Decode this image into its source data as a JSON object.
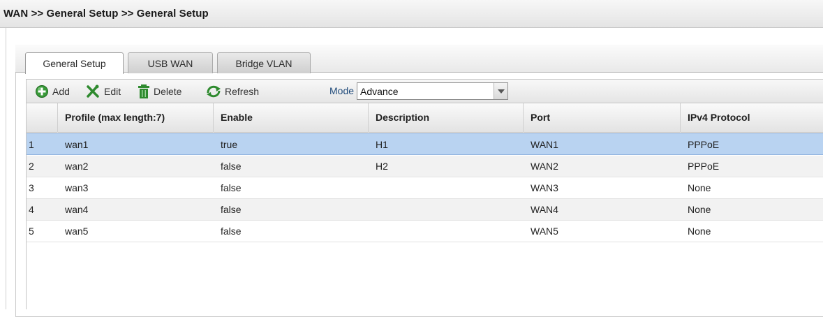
{
  "breadcrumb": "WAN >> General Setup >> General Setup",
  "tabs": [
    {
      "label": "General Setup",
      "active": true
    },
    {
      "label": "USB WAN",
      "active": false
    },
    {
      "label": "Bridge VLAN",
      "active": false
    }
  ],
  "toolbar": {
    "add_label": "Add",
    "edit_label": "Edit",
    "delete_label": "Delete",
    "refresh_label": "Refresh",
    "mode_label": "Mode :",
    "mode_value": "Advance"
  },
  "table": {
    "headers": [
      "",
      "Profile (max length:7)",
      "Enable",
      "Description",
      "Port",
      "IPv4 Protocol"
    ],
    "rows": [
      {
        "num": "1",
        "profile": "wan1",
        "enable": "true",
        "description": "H1",
        "port": "WAN1",
        "protocol": "PPPoE",
        "selected": true
      },
      {
        "num": "2",
        "profile": "wan2",
        "enable": "false",
        "description": "H2",
        "port": "WAN2",
        "protocol": "PPPoE"
      },
      {
        "num": "3",
        "profile": "wan3",
        "enable": "false",
        "description": "",
        "port": "WAN3",
        "protocol": "None"
      },
      {
        "num": "4",
        "profile": "wan4",
        "enable": "false",
        "description": "",
        "port": "WAN4",
        "protocol": "None"
      },
      {
        "num": "5",
        "profile": "wan5",
        "enable": "false",
        "description": "",
        "port": "WAN5",
        "protocol": "None"
      }
    ]
  },
  "colors": {
    "selected_row": "#b9d3f1",
    "mode_label": "#1f4a7a",
    "icon_green": "#3a9a3a"
  }
}
